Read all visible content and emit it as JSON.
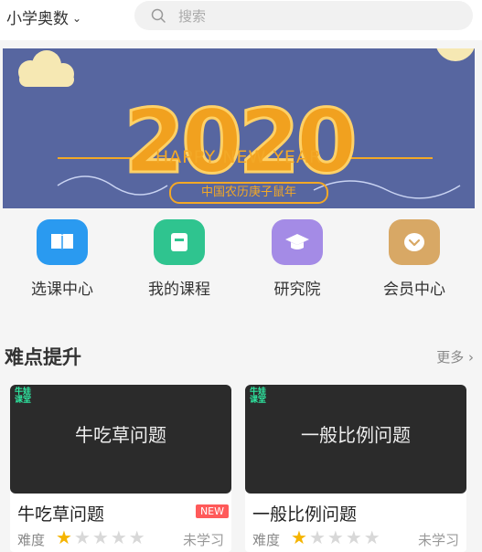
{
  "header": {
    "subject_label": "小学奥数",
    "search_placeholder": "搜索"
  },
  "banner": {
    "year": "2020",
    "greeting": "HAPPY NEW YEAR",
    "lunar": "中国农历庚子鼠年"
  },
  "shortcuts": [
    {
      "label": "选课中心",
      "icon": "book-icon",
      "color": "#2a9af0"
    },
    {
      "label": "我的课程",
      "icon": "notebook-icon",
      "color": "#2fc48f"
    },
    {
      "label": "研究院",
      "icon": "graduation-cap-icon",
      "color": "#a48be6"
    },
    {
      "label": "会员中心",
      "icon": "diamond-icon",
      "color": "#d8a865"
    }
  ],
  "section": {
    "title": "难点提升",
    "more_label": "更多 ›"
  },
  "cards": [
    {
      "thumb_badge": "牛娃课堂",
      "thumb_title": "牛吃草问题",
      "title": "牛吃草问题",
      "badge": "NEW",
      "difficulty_label": "难度",
      "difficulty": 1,
      "difficulty_max": 5,
      "status": "未学习"
    },
    {
      "thumb_badge": "牛娃课堂",
      "thumb_title": "一般比例问题",
      "title": "一般比例问题",
      "badge": "",
      "difficulty_label": "难度",
      "difficulty": 1,
      "difficulty_max": 5,
      "status": "未学习"
    }
  ]
}
